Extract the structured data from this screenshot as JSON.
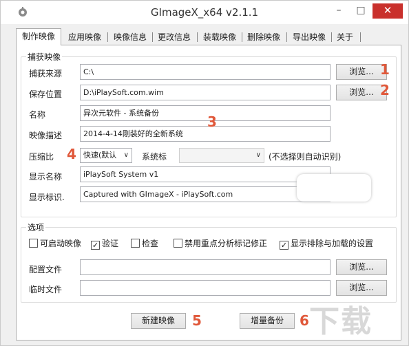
{
  "window": {
    "title": "GImageX_x64 v2.1.1",
    "minimize": "–",
    "maximize": "□",
    "close": "✕"
  },
  "tabs": [
    "制作映像",
    "应用映像",
    "映像信息",
    "更改信息",
    "装载映像",
    "删除映像",
    "导出映像",
    "关于"
  ],
  "capture_group": {
    "title": "捕获映像",
    "source_label": "捕获来源",
    "source_value": "C:\\",
    "save_label": "保存位置",
    "save_value": "D:\\iPlaySoft.com.wim",
    "name_label": "名称",
    "name_value": "异次元软件 - 系统备份",
    "desc_label": "映像描述",
    "desc_value": "2014-4-14刚装好的全新系统",
    "compress_label": "压缩比",
    "compress_value": "快速(默认",
    "system_label": "系统标",
    "system_value": "",
    "system_hint": "(不选择则自动识别)",
    "display_name_label": "显示名称",
    "display_name_value": "iPlaySoft System v1",
    "display_flag_label": "显示标识.",
    "display_flag_value": "Captured with GImageX - iPlaySoft.com",
    "browse": "浏览..."
  },
  "options_group": {
    "title": "选项",
    "checks": [
      {
        "label": "可启动映像",
        "checked": false
      },
      {
        "label": "验证",
        "checked": true
      },
      {
        "label": "检查",
        "checked": false
      },
      {
        "label": "禁用重点分析标记修正",
        "checked": false
      },
      {
        "label": "显示排除与加载的设置",
        "checked": true
      }
    ],
    "config_label": "配置文件",
    "config_value": "",
    "temp_label": "临时文件",
    "temp_value": "",
    "browse": "浏览..."
  },
  "actions": {
    "new_image": "新建映像",
    "incremental": "增量备份"
  },
  "annotations": [
    "1",
    "2",
    "3",
    "4",
    "5",
    "6"
  ],
  "colors": {
    "annotation": "#e0583a",
    "close_button": "#c9302c"
  }
}
